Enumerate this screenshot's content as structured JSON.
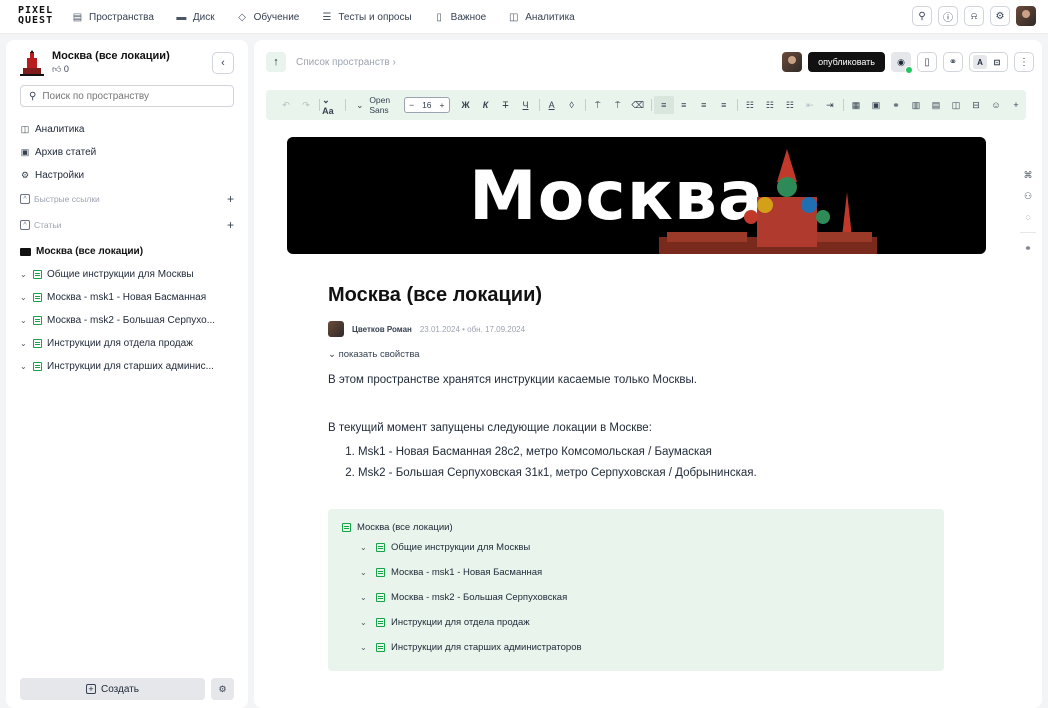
{
  "topbar": {
    "logo": "PIXEL QUEST",
    "nav": [
      {
        "label": "Пространства",
        "icon": "spaces-icon"
      },
      {
        "label": "Диск",
        "icon": "folder-icon"
      },
      {
        "label": "Обучение",
        "icon": "graduation-icon"
      },
      {
        "label": "Тесты и опросы",
        "icon": "tests-icon"
      },
      {
        "label": "Важное",
        "icon": "bookmark-icon"
      },
      {
        "label": "Аналитика",
        "icon": "analytics-icon"
      }
    ]
  },
  "sidebar": {
    "space_title": "Москва (все локации)",
    "likes": "0",
    "search_placeholder": "Поиск по пространству",
    "menu": [
      {
        "label": "Аналитика",
        "icon": "analytics-icon"
      },
      {
        "label": "Архив статей",
        "icon": "archive-icon"
      },
      {
        "label": "Настройки",
        "icon": "gear-icon"
      }
    ],
    "quick_links_label": "Быстрые ссылки",
    "articles_label": "Статьи",
    "tree_root": "Москва (все локации)",
    "tree_items": [
      "Общие инструкции для Москвы",
      "Москва - msk1 - Новая Басманная",
      "Москва - msk2 - Большая Серпухо...",
      "Инструкции для отдела продаж",
      "Инструкции для старших админис..."
    ],
    "create_label": "Создать"
  },
  "main": {
    "breadcrumb": "Список пространств",
    "publish_label": "опубликовать",
    "font_name": "Open Sans",
    "font_size": "16",
    "banner_text": "Москва",
    "title": "Москва (все локации)",
    "author": "Цветков Роман",
    "dates": "23.01.2024 • обн. 17.09.2024",
    "show_props": "показать свойства",
    "paragraph1": "В этом пространстве хранятся инструкции касаемые только Москвы.",
    "paragraph2": "В текущий момент запущены следующие локации в Москве:",
    "list": [
      "Msk1 - Новая Басманная 28с2, метро Комсомольская / Баумаская",
      "Msk2 - Большая Серпуховская 31к1, метро Серпуховская / Добрынинская."
    ],
    "subpages_root": "Москва (все локации)",
    "subpages": [
      "Общие инструкции для Москвы",
      "Москва - msk1 - Новая Басманная",
      "Москва - msk2 - Большая Серпуховская",
      "Инструкции для отдела продаж",
      "Инструкции для старших администраторов"
    ]
  },
  "colors": {
    "accent_green": "#16a34a",
    "toolbar_bg": "#e8f4ec",
    "publish_bg": "#111111"
  }
}
